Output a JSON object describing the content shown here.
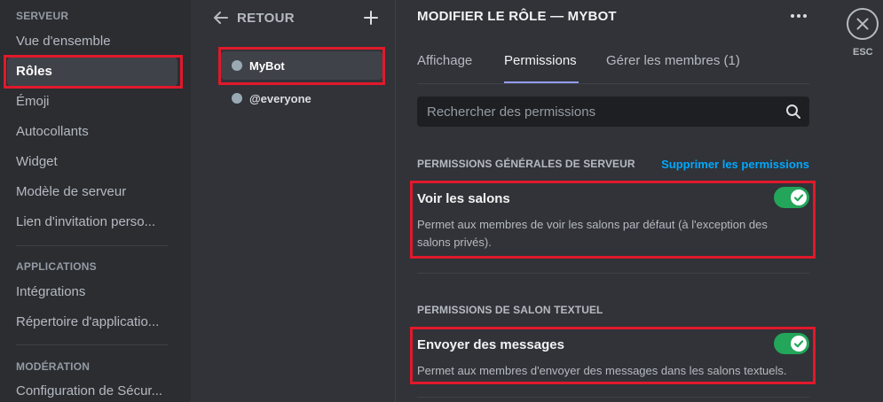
{
  "sidebar": {
    "sections": [
      {
        "header": "SERVEUR",
        "items": [
          "Vue d'ensemble",
          "Rôles",
          "Émoji",
          "Autocollants",
          "Widget",
          "Modèle de serveur",
          "Lien d'invitation perso..."
        ]
      },
      {
        "header": "APPLICATIONS",
        "items": [
          "Intégrations",
          "Répertoire d'applicatio..."
        ]
      },
      {
        "header": "MODÉRATION",
        "items": [
          "Configuration de Sécur..."
        ]
      }
    ],
    "selected": "Rôles"
  },
  "roles_panel": {
    "back_label": "RETOUR",
    "roles": [
      {
        "name": "MyBot",
        "color": "#99aab5",
        "selected": true
      },
      {
        "name": "@everyone",
        "color": "#99aab5",
        "selected": false
      }
    ]
  },
  "main": {
    "title": "MODIFIER LE RÔLE — MYBOT",
    "tabs": [
      "Affichage",
      "Permissions",
      "Gérer les membres (1)"
    ],
    "active_tab": "Permissions",
    "search_placeholder": "Rechercher des permissions",
    "groups": [
      {
        "header": "PERMISSIONS GÉNÉRALES DE SERVEUR",
        "action": "Supprimer les permissions",
        "permissions": [
          {
            "title": "Voir les salons",
            "desc_line1": "Permet aux membres de voir les salons par défaut (à l'exception des",
            "desc_line2": "salons privés).",
            "enabled": true
          }
        ]
      },
      {
        "header": "PERMISSIONS DE SALON TEXTUEL",
        "permissions": [
          {
            "title": "Envoyer des messages",
            "desc_line1": "Permet aux membres d'envoyer des messages dans les salons textuels.",
            "enabled": true
          }
        ]
      }
    ]
  },
  "close": {
    "label": "ESC"
  },
  "colors": {
    "accent": "#949cf7",
    "toggle_on": "#23a55a",
    "link": "#00a8fc",
    "highlight": "#e0192b"
  }
}
